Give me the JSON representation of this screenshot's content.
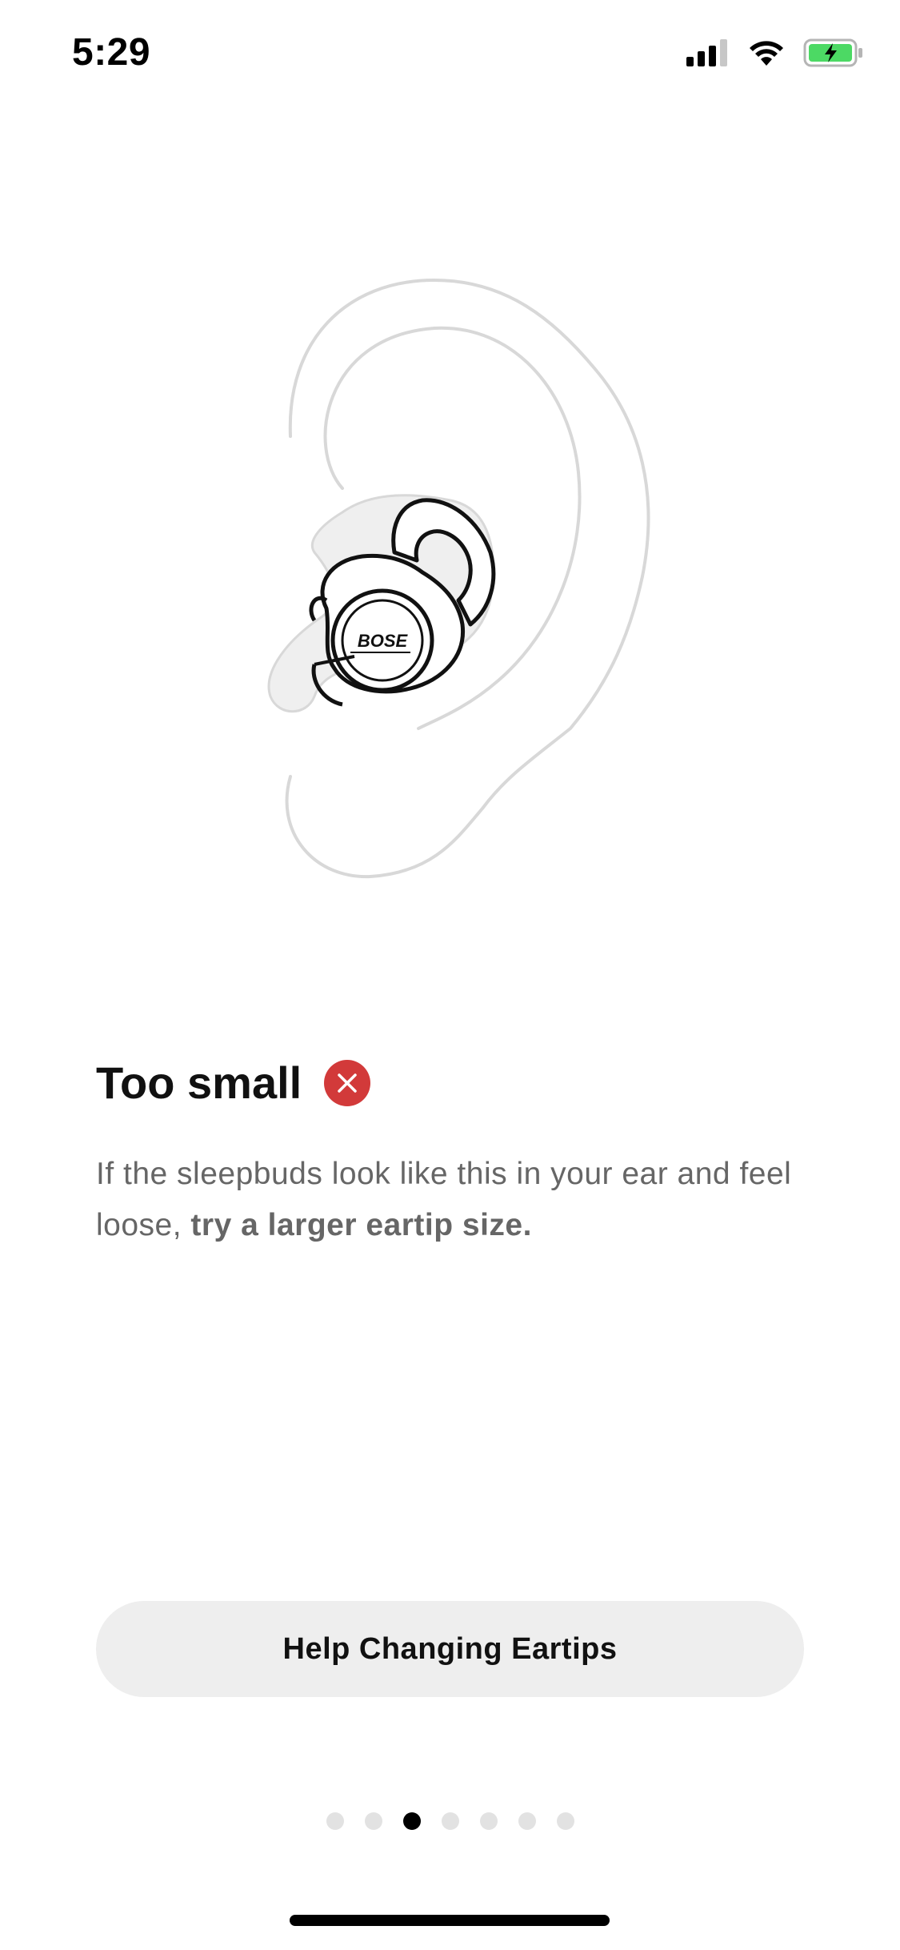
{
  "status_bar": {
    "time": "5:29",
    "icons": [
      "signal-icon",
      "wifi-icon",
      "battery-charging-icon"
    ],
    "battery_color": "#4cd964"
  },
  "illustration": {
    "icon": "ear-with-sleepbud-illustration",
    "brand_text": "BOSE"
  },
  "fit_result": {
    "title": "Too small",
    "status_icon": "error-x-icon",
    "status_color": "#d23a3a",
    "description_plain": "If the sleepbuds look like this in your ear and feel loose, ",
    "description_bold": "try a larger eartip size."
  },
  "actions": {
    "help_button_label": "Help Changing Eartips"
  },
  "pagination": {
    "total": 7,
    "current": 3
  }
}
